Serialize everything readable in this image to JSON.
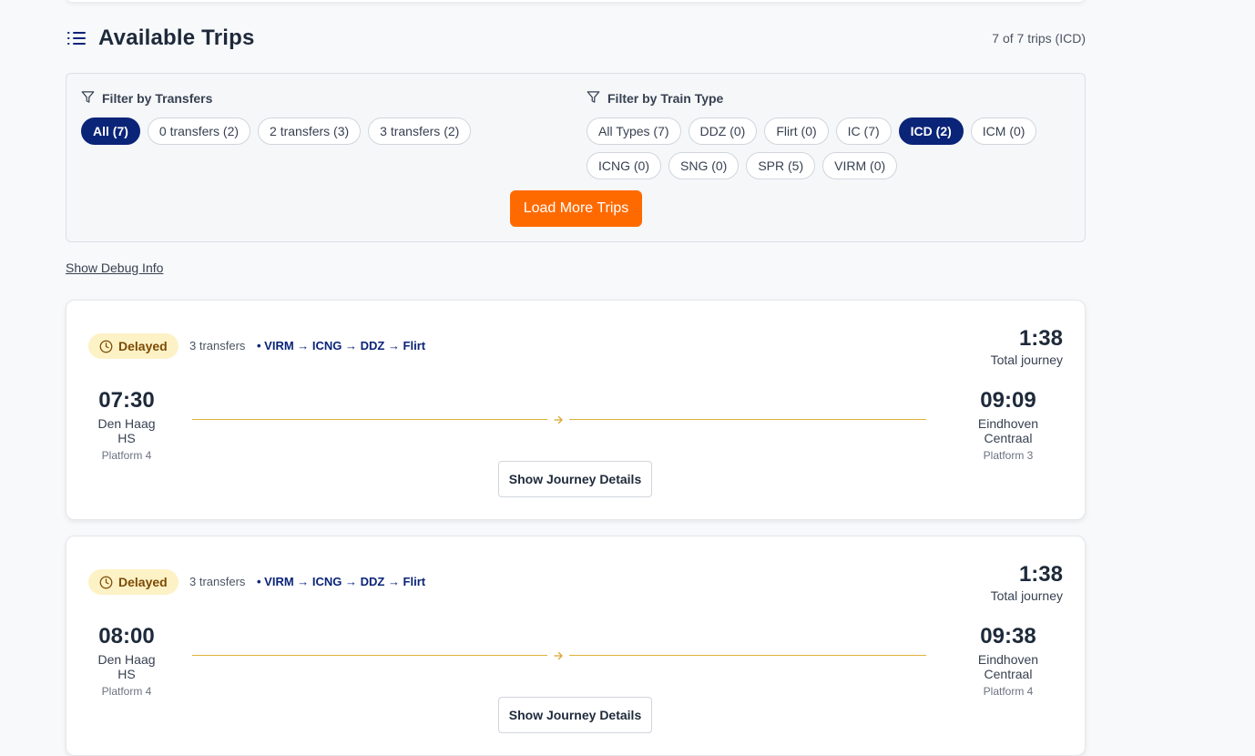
{
  "header": {
    "title": "Available Trips",
    "trip_count": "7 of 7 trips (ICD)"
  },
  "filters": {
    "transfers_label": "Filter by Transfers",
    "transfers": [
      {
        "label": "All (7)",
        "active": true
      },
      {
        "label": "0 transfers (2)",
        "active": false
      },
      {
        "label": "2 transfers (3)",
        "active": false
      },
      {
        "label": "3 transfers (2)",
        "active": false
      }
    ],
    "types_label": "Filter by Train Type",
    "types": [
      {
        "label": "All Types (7)",
        "active": false
      },
      {
        "label": "DDZ (0)",
        "active": false
      },
      {
        "label": "Flirt (0)",
        "active": false
      },
      {
        "label": "IC (7)",
        "active": false
      },
      {
        "label": "ICD (2)",
        "active": true
      },
      {
        "label": "ICM (0)",
        "active": false
      },
      {
        "label": "ICNG (0)",
        "active": false
      },
      {
        "label": "SNG (0)",
        "active": false
      },
      {
        "label": "SPR (5)",
        "active": false
      },
      {
        "label": "VIRM (0)",
        "active": false
      }
    ],
    "load_more_label": "Load More Trips"
  },
  "debug_link": "Show Debug Info",
  "trips": [
    {
      "status": "Delayed",
      "transfers": "3 transfers",
      "route": "• VIRM → ICNG → DDZ → Flirt",
      "duration": "1:38",
      "duration_label": "Total journey",
      "departure": {
        "time": "07:30",
        "station": "Den Haag HS",
        "platform": "Platform 4"
      },
      "arrival": {
        "time": "09:09",
        "station": "Eindhoven Centraal",
        "platform": "Platform 3"
      },
      "details_label": "Show Journey Details"
    },
    {
      "status": "Delayed",
      "transfers": "3 transfers",
      "route": "• VIRM → ICNG → DDZ → Flirt",
      "duration": "1:38",
      "duration_label": "Total journey",
      "departure": {
        "time": "08:00",
        "station": "Den Haag HS",
        "platform": "Platform 4"
      },
      "arrival": {
        "time": "09:38",
        "station": "Eindhoven Centraal",
        "platform": "Platform 4"
      },
      "details_label": "Show Journey Details"
    }
  ],
  "colors": {
    "accent_navy": "#0a2478",
    "load_more_orange": "#ff6a00",
    "delayed_badge_bg": "#fdf2c6",
    "track_gold": "#e0b23a"
  },
  "icons": [
    "list-icon",
    "filter-icon",
    "clock-icon",
    "arrow-right-icon"
  ]
}
